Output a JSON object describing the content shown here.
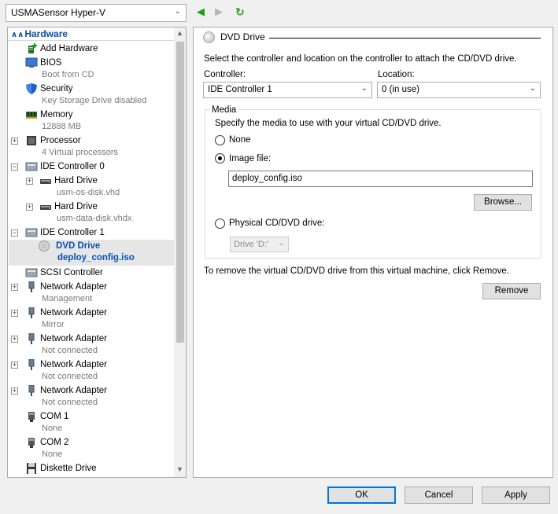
{
  "toolbar": {
    "vm_name": "USMASensor Hyper-V",
    "back_glyph": "◀",
    "forward_glyph": "▶",
    "refresh_glyph": "↻"
  },
  "tree": {
    "section": "Hardware",
    "items": [
      {
        "label": "Add Hardware",
        "icon": "add-hardware-icon"
      },
      {
        "label": "BIOS",
        "sub": "Boot from CD",
        "icon": "bios-icon"
      },
      {
        "label": "Security",
        "sub": "Key Storage Drive disabled",
        "icon": "shield-icon"
      },
      {
        "label": "Memory",
        "sub": "12888 MB",
        "icon": "memory-icon"
      },
      {
        "label": "Processor",
        "sub": "4 Virtual processors",
        "icon": "processor-icon"
      },
      {
        "label": "IDE Controller 0",
        "icon": "ide-controller-icon"
      },
      {
        "label": "Hard Drive",
        "sub": "usm-os-disk.vhd",
        "icon": "hard-drive-icon"
      },
      {
        "label": "Hard Drive",
        "sub": "usm-data-disk.vhdx",
        "icon": "hard-drive-icon"
      },
      {
        "label": "IDE Controller 1",
        "icon": "ide-controller-icon"
      },
      {
        "label": "DVD Drive",
        "sub": "deploy_config.iso",
        "icon": "dvd-drive-icon"
      },
      {
        "label": "SCSI Controller",
        "icon": "scsi-controller-icon"
      },
      {
        "label": "Network Adapter",
        "sub": "Management",
        "icon": "network-adapter-icon"
      },
      {
        "label": "Network Adapter",
        "sub": "Mirror",
        "icon": "network-adapter-icon"
      },
      {
        "label": "Network Adapter",
        "sub": "Not connected",
        "icon": "network-adapter-icon"
      },
      {
        "label": "Network Adapter",
        "sub": "Not connected",
        "icon": "network-adapter-icon"
      },
      {
        "label": "Network Adapter",
        "sub": "Not connected",
        "icon": "network-adapter-icon"
      },
      {
        "label": "COM 1",
        "sub": "None",
        "icon": "com-port-icon"
      },
      {
        "label": "COM 2",
        "sub": "None",
        "icon": "com-port-icon"
      },
      {
        "label": "Diskette Drive",
        "icon": "diskette-icon"
      }
    ]
  },
  "pane": {
    "title": "DVD Drive",
    "instructions": "Select the controller and location on the controller to attach the CD/DVD drive.",
    "controller_label": "Controller:",
    "controller_value": "IDE Controller 1",
    "location_label": "Location:",
    "location_value": "0 (in use)",
    "media_label": "Media",
    "media_instructions": "Specify the media to use with your virtual CD/DVD drive.",
    "opt_none": "None",
    "opt_image": "Image file:",
    "image_path": "deploy_config.iso",
    "browse": "Browse...",
    "opt_physical": "Physical CD/DVD drive:",
    "physical_drive": "Drive 'D:'",
    "remove_instructions": "To remove the virtual CD/DVD drive from this virtual machine, click Remove.",
    "remove": "Remove"
  },
  "footer": {
    "ok": "OK",
    "cancel": "Cancel",
    "apply": "Apply"
  }
}
